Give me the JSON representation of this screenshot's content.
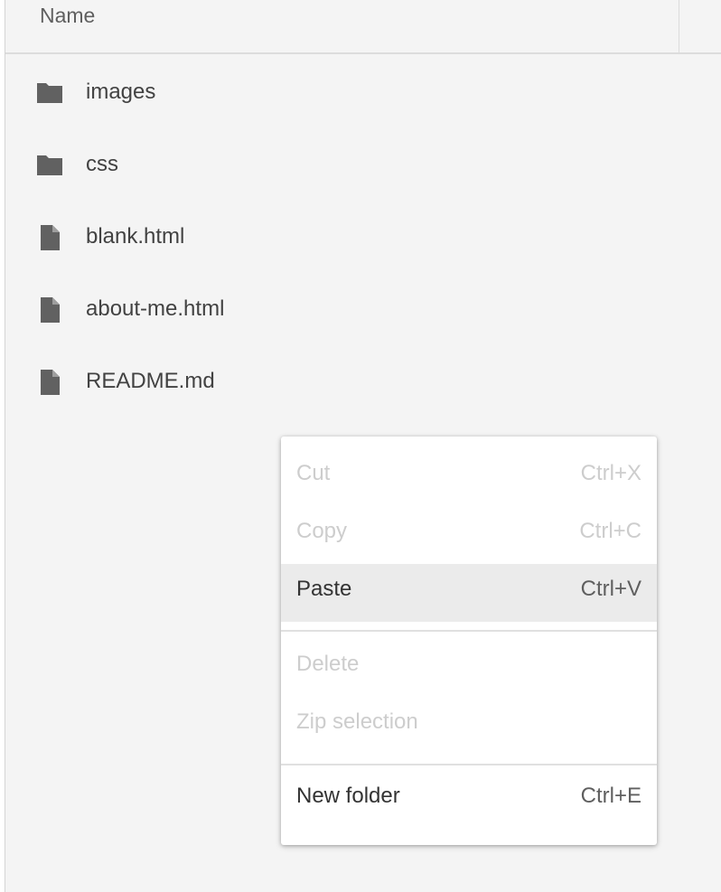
{
  "header": {
    "name_label": "Name"
  },
  "files": [
    {
      "name": "images",
      "icon": "folder-icon"
    },
    {
      "name": "css",
      "icon": "folder-icon"
    },
    {
      "name": "blank.html",
      "icon": "file-icon"
    },
    {
      "name": "about-me.html",
      "icon": "file-icon"
    },
    {
      "name": "README.md",
      "icon": "file-icon"
    }
  ],
  "context_menu": {
    "items": [
      {
        "label": "Cut",
        "shortcut": "Ctrl+X",
        "state": "disabled"
      },
      {
        "label": "Copy",
        "shortcut": "Ctrl+C",
        "state": "disabled"
      },
      {
        "label": "Paste",
        "shortcut": "Ctrl+V",
        "state": "enabled-highlighted"
      },
      {
        "label": "Delete",
        "shortcut": "",
        "state": "disabled"
      },
      {
        "label": "Zip selection",
        "shortcut": "",
        "state": "disabled"
      },
      {
        "label": "New folder",
        "shortcut": "Ctrl+E",
        "state": "enabled"
      }
    ]
  },
  "colors": {
    "background": "#f4f4f4",
    "icon": "#616161",
    "text": "#424242",
    "disabled_text": "#cdcdcd",
    "highlight": "#ebebeb"
  }
}
